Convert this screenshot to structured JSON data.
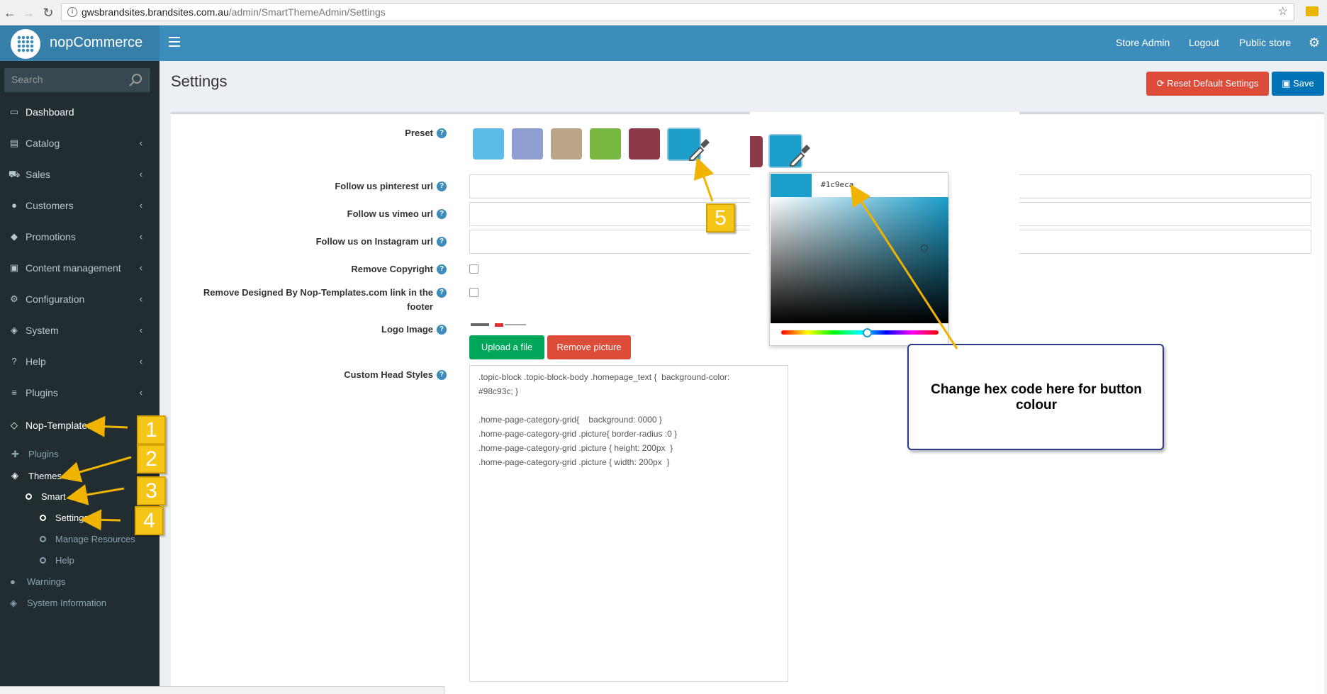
{
  "browser": {
    "url_host": "gwsbrandsites.brandsites.com.au",
    "url_path": "/admin/SmartThemeAdmin/Settings"
  },
  "header": {
    "logo_text": "nopCommerce",
    "links": [
      "Store Admin",
      "Logout",
      "Public store"
    ]
  },
  "sidebar": {
    "search_placeholder": "Search",
    "items": [
      {
        "label": "Dashboard",
        "icon": "desktop-icon"
      },
      {
        "label": "Catalog",
        "icon": "book-icon"
      },
      {
        "label": "Sales",
        "icon": "cart-icon"
      },
      {
        "label": "Customers",
        "icon": "user-icon"
      },
      {
        "label": "Promotions",
        "icon": "tags-icon"
      },
      {
        "label": "Content management",
        "icon": "cubes-icon"
      },
      {
        "label": "Configuration",
        "icon": "gears-icon"
      },
      {
        "label": "System",
        "icon": "cube-icon"
      },
      {
        "label": "Help",
        "icon": "question-icon"
      },
      {
        "label": "Plugins",
        "icon": "bars-icon"
      },
      {
        "label": "Nop-Templates",
        "icon": "diamond-icon"
      }
    ],
    "sub": {
      "plugins": "Plugins",
      "themes": "Themes",
      "smart": "Smart",
      "settings": "Settings",
      "manage_resources": "Manage Resources",
      "help": "Help",
      "warnings": "Warnings",
      "system_information": "System Information"
    }
  },
  "page": {
    "title": "Settings",
    "reset_label": "Reset Default Settings",
    "save_label": "Save"
  },
  "form": {
    "preset_label": "Preset",
    "preset_colors": [
      "#5bbcea",
      "#8e9ed0",
      "#bba68a",
      "#77b840",
      "#8c3a4a",
      "#1c9eca"
    ],
    "pinterest_label": "Follow us pinterest url",
    "vimeo_label": "Follow us vimeo url",
    "instagram_label": "Follow us on Instagram url",
    "remove_copyright_label": "Remove Copyright",
    "remove_designed_label": "Remove Designed By Nop-Templates.com link in the footer",
    "logo_label": "Logo Image",
    "upload_label": "Upload a file",
    "remove_picture_label": "Remove picture",
    "custom_styles_label": "Custom Head Styles",
    "custom_styles_value": ".topic-block .topic-block-body .homepage_text {  background-color: \n#98c93c; }\n\n.home-page-category-grid{    background: 0000 }\n.home-page-category-grid .picture{ border-radius :0 }\n.home-page-category-grid .picture { height: 200px  }\n.home-page-category-grid .picture { width: 200px  }"
  },
  "picker": {
    "hex": "#1c9eca",
    "color": "#1c9eca"
  },
  "annotations": {
    "callout": "Change hex code here for button colour",
    "badges": [
      "1",
      "2",
      "3",
      "4",
      "5"
    ]
  }
}
